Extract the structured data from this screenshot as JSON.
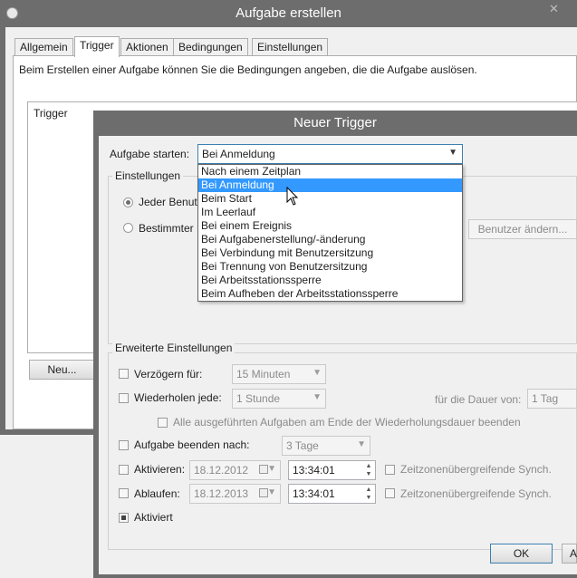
{
  "main_window": {
    "title": "Aufgabe erstellen",
    "tabs": [
      {
        "label": "Allgemein"
      },
      {
        "label": "Trigger"
      },
      {
        "label": "Aktionen"
      },
      {
        "label": "Bedingungen"
      },
      {
        "label": "Einstellungen"
      }
    ],
    "description": "Beim Erstellen einer Aufgabe können Sie die Bedingungen angeben, die die Aufgabe auslösen.",
    "trigger_list_header": "Trigger",
    "new_button": "Neu..."
  },
  "dialog": {
    "title": "Neuer Trigger",
    "start_label": "Aufgabe starten:",
    "start_value": "Bei Anmeldung",
    "dropdown_options": [
      "Nach einem Zeitplan",
      "Bei Anmeldung",
      "Beim Start",
      "Im Leerlauf",
      "Bei einem Ereignis",
      "Bei Aufgabenerstellung/-änderung",
      "Bei Verbindung mit Benutzersitzung",
      "Bei Trennung von Benutzersitzung",
      "Bei Arbeitsstationssperre",
      "Beim Aufheben der Arbeitsstationssperre"
    ],
    "selected_option": "Bei Anmeldung",
    "settings_group": "Einstellungen",
    "radio_any_user": "Jeder Benutz",
    "radio_specific_user": "Bestimmter B",
    "change_user_button": "Benutzer ändern...",
    "advanced_group": "Erweiterte Einstellungen",
    "delay_label": "Verzögern für:",
    "delay_value": "15 Minuten",
    "repeat_label": "Wiederholen jede:",
    "repeat_value": "1 Stunde",
    "duration_label": "für die Dauer von:",
    "duration_value": "1 Tag",
    "stop_all_label": "Alle ausgeführten Aufgaben am Ende der Wiederholungsdauer beenden",
    "stop_after_label": "Aufgabe beenden nach:",
    "stop_after_value": "3 Tage",
    "activate_label": "Aktivieren:",
    "activate_date": "18.12.2012",
    "activate_time": "13:34:01",
    "expire_label": "Ablaufen:",
    "expire_date": "18.12.2013",
    "expire_time": "13:34:01",
    "sync_label": "Zeitzonenübergreifende Synch.",
    "enabled_label": "Aktiviert",
    "ok_button": "OK",
    "cancel_button_partial": "A"
  }
}
